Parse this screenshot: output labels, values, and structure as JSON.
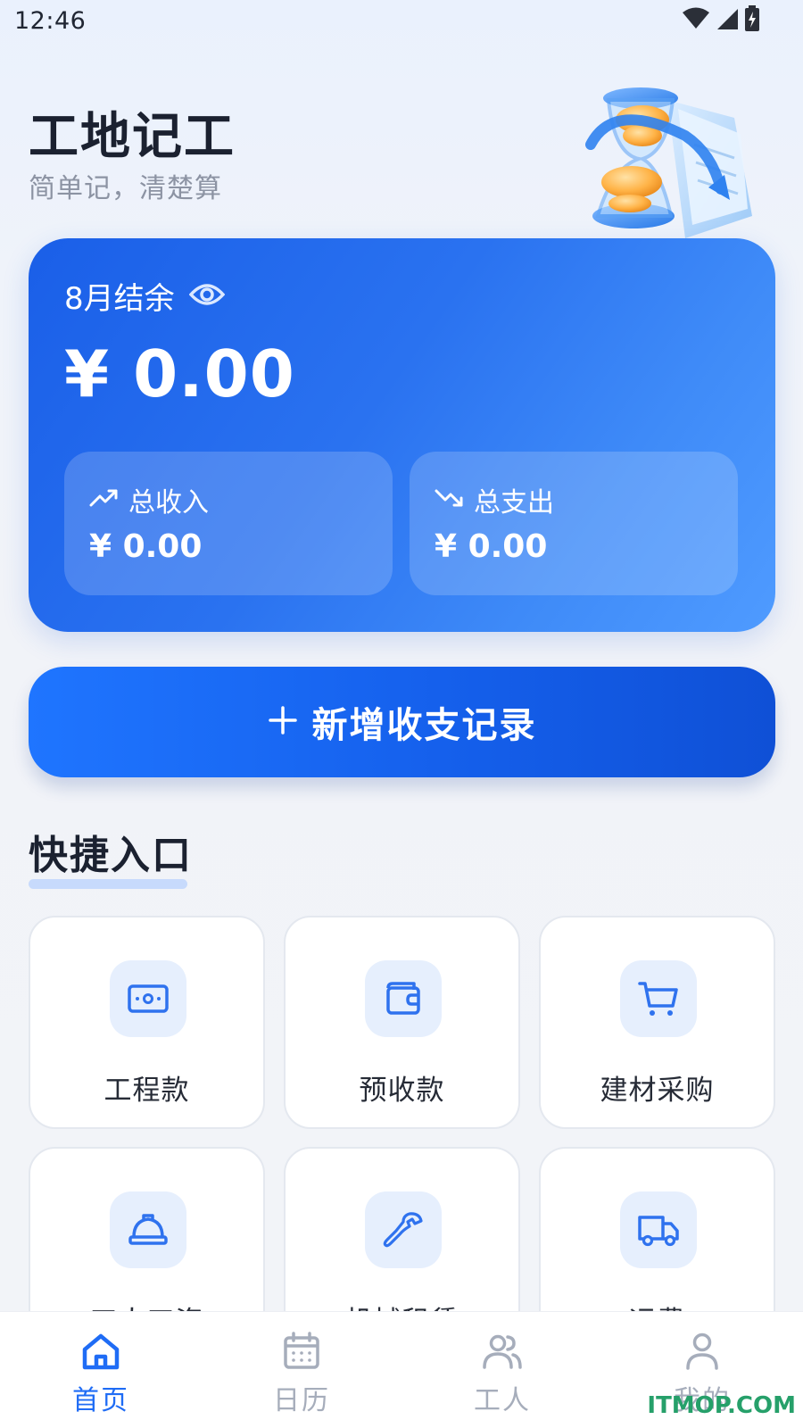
{
  "status_bar": {
    "time": "12:46",
    "icons": [
      "wifi-icon",
      "cellular-signal-icon",
      "battery-charging-icon"
    ]
  },
  "header": {
    "title": "工地记工",
    "subtitle": "简单记，清楚算",
    "illustration": "hourglass-coins-illustration"
  },
  "balance_card": {
    "label": "8月结余",
    "visibility_icon": "eye-icon",
    "amount": "¥ 0.00",
    "income": {
      "icon": "trending-up-icon",
      "label": "总收入",
      "value": "¥ 0.00"
    },
    "expense": {
      "icon": "trending-down-icon",
      "label": "总支出",
      "value": "¥ 0.00"
    }
  },
  "add_button": {
    "icon": "plus-icon",
    "label": "新增收支记录"
  },
  "quick_section": {
    "title": "快捷入口",
    "items": [
      {
        "label": "工程款",
        "icon": "banknote-icon"
      },
      {
        "label": "预收款",
        "icon": "wallet-icon"
      },
      {
        "label": "建材采购",
        "icon": "shopping-cart-icon"
      },
      {
        "label": "工人工资",
        "icon": "hard-hat-icon"
      },
      {
        "label": "机械租赁",
        "icon": "wrench-icon"
      },
      {
        "label": "运费",
        "icon": "truck-icon"
      }
    ]
  },
  "bottom_nav": {
    "active_index": 0,
    "items": [
      {
        "label": "首页",
        "icon": "home-icon"
      },
      {
        "label": "日历",
        "icon": "calendar-icon"
      },
      {
        "label": "工人",
        "icon": "users-icon"
      },
      {
        "label": "我的",
        "icon": "user-icon"
      }
    ]
  },
  "colors": {
    "accent": "#1f6cf5",
    "card_gradient_start": "#1a5fe8",
    "card_gradient_end": "#4f9bff",
    "nav_inactive": "#a6adbb",
    "tile_icon_bg": "#e6effd"
  },
  "watermark": "ITMOP.COM"
}
